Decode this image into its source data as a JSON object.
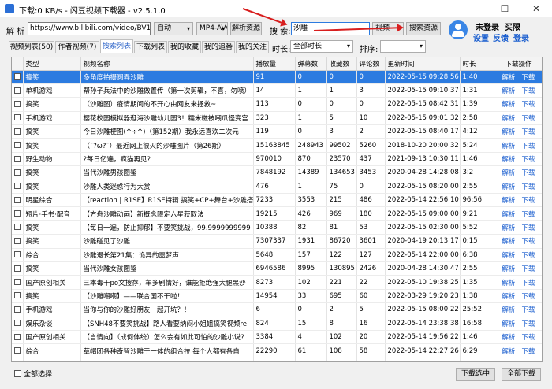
{
  "window": {
    "title": "下载:0 KB/s - 闪豆视频下载器 - v2.5.1.0",
    "minimize": "—",
    "maximize": "☐",
    "close": "✕"
  },
  "toolbar": {
    "parse_label": "解 析",
    "url_value": "https://www.bilibili.com/video/BV18",
    "mode_value": "自动",
    "format_value": "MP4-AVC",
    "parse_button": "解析资源",
    "search_label": "搜 索:",
    "search_value": "沙雕",
    "search_select": "视频",
    "search_button": "搜索资源"
  },
  "user": {
    "status": "未登录",
    "vip": "买限",
    "settings": "设置",
    "feedback": "反馈",
    "login": "登录"
  },
  "tabs": [
    "视频列表(50)",
    "作者视频(7)",
    "搜索列表",
    "下载列表",
    "我的收藏",
    "我的追番",
    "我的关注"
  ],
  "filters": {
    "duration_label": "时长:",
    "duration_value": "全部时长",
    "sort_label": "排序:",
    "sort_value": ""
  },
  "table": {
    "columns": [
      "",
      "类型",
      "视频名称",
      "播放量",
      "弹幕数",
      "收藏数",
      "评论数",
      "更新时间",
      "时长",
      "下载操作"
    ],
    "action_parse": "解析",
    "action_download": "下载",
    "rows": [
      [
        "搞笑",
        "多角度拍摄圆弄沙雕",
        "91",
        "0",
        "0",
        "0",
        "2022-05-15 09:28:56",
        "1:40"
      ],
      [
        "单机游戏",
        "帮孙子兵法中的沙雕做置传（第一次剪辑，不喜，勿喷）",
        "14",
        "1",
        "1",
        "3",
        "2022-05-15 09:10:37",
        "1:31"
      ],
      [
        "搞笑",
        "（沙雕图）疫情期间的不开心由网友来拯救~",
        "113",
        "0",
        "0",
        "0",
        "2022-05-15 08:42:31",
        "1:39"
      ],
      [
        "手机游戏",
        "樱花校园模拟器逛海沙雕幼儿园3！糯米糍被嘲瓜怪变宫",
        "323",
        "1",
        "5",
        "10",
        "2022-05-15 09:01:32",
        "2:58"
      ],
      [
        "搞笑",
        "今日沙雕梗图(^÷^)（第152期）我永远喜欢二次元",
        "119",
        "0",
        "3",
        "2",
        "2022-05-15 08:40:17",
        "4:12"
      ],
      [
        "搞笑",
        "（¯?ω?¯）最近网上很火的沙雕图片（第26期）",
        "15163845",
        "248943",
        "99502",
        "5260",
        "2018-10-20 20:00:32",
        "5:24"
      ],
      [
        "野生动物",
        "?每日亿遍，疯猫再见?",
        "970010",
        "870",
        "23570",
        "437",
        "2021-09-13 10:30:11",
        "1:46"
      ],
      [
        "搞笑",
        "当代沙雕男孩图鉴",
        "7848192",
        "14389",
        "134653",
        "3453",
        "2020-04-28 14:28:08",
        "3:2"
      ],
      [
        "搞笑",
        "沙雕人类迷惑行为大赏",
        "476",
        "1",
        "75",
        "0",
        "2022-05-15 08:20:00",
        "2:55"
      ],
      [
        "明星综合",
        "【reaction | R1SE】R1SE特辑 搞笑+CP+舞台+沙雕搭",
        "7233",
        "3553",
        "215",
        "486",
        "2022-05-14 22:56:10",
        "96:56"
      ],
      [
        "短片·手书·配音",
        "【方舟沙雕动画】新概念限定六星获取法",
        "19215",
        "426",
        "969",
        "180",
        "2022-05-15 09:00:00",
        "9:21"
      ],
      [
        "搞笑",
        "【每日一遍，防止抑郁】不要笑挑战，99.9999999999",
        "10388",
        "82",
        "81",
        "53",
        "2022-05-15 02:30:00",
        "5:52"
      ],
      [
        "搞笑",
        "沙雕碰见了沙雕",
        "7307337",
        "1931",
        "86720",
        "3601",
        "2020-04-19 20:13:17",
        "0:15"
      ],
      [
        "综合",
        "沙雕退长第21集：诡异的噩梦声",
        "5648",
        "157",
        "122",
        "127",
        "2022-05-14 22:00:00",
        "6:38"
      ],
      [
        "搞笑",
        "当代沙雕女孩图鉴",
        "6946586",
        "8995",
        "130895",
        "2426",
        "2020-04-28 14:30:47",
        "2:55"
      ],
      [
        "国产原创相关",
        "三本毒干po文搜存，车多剧情好，谁能拒绝强大腿黑沙",
        "8273",
        "102",
        "221",
        "22",
        "2022-05-10 19:38:25",
        "1:35"
      ],
      [
        "搞笑",
        "【沙雕嘲嘲】——联合国不干啦！",
        "14954",
        "33",
        "695",
        "60",
        "2022-03-29 19:20:23",
        "1:38"
      ],
      [
        "手机游戏",
        "当你与你的沙雕好朋友一起开坑？！",
        "6",
        "0",
        "2",
        "5",
        "2022-05-15 08:00:22",
        "25:52"
      ],
      [
        "娱乐杂谈",
        "【SNH48不要笑挑战】路人看要纳闷小姐姐搞笑视频re",
        "824",
        "15",
        "8",
        "16",
        "2022-05-14 23:38:38",
        "16:58"
      ],
      [
        "国产原创相关",
        "【言情向】（成何体统）怎么会有如此可怕的沙雕小说?",
        "3384",
        "4",
        "102",
        "20",
        "2022-05-14 19:56:22",
        "1:46"
      ],
      [
        "综合",
        "草帽团各种奇智沙雕于一体的组合技 每个人都有各自",
        "22290",
        "61",
        "108",
        "58",
        "2022-05-14 22:27:26",
        "6:29"
      ],
      [
        "综合",
        "第153集 沙雕搞笑日常了",
        "2615",
        "6",
        "13",
        "12",
        "2022-05-14 16:49:17",
        "4:58"
      ]
    ]
  },
  "footer": {
    "select_all": "全部选择",
    "download_selected": "下载选中",
    "download_all": "全部下载"
  },
  "colors": {
    "selection": "#2c7be0",
    "link": "#1a5ecf",
    "annotation_arrow": "#d81e1e"
  }
}
